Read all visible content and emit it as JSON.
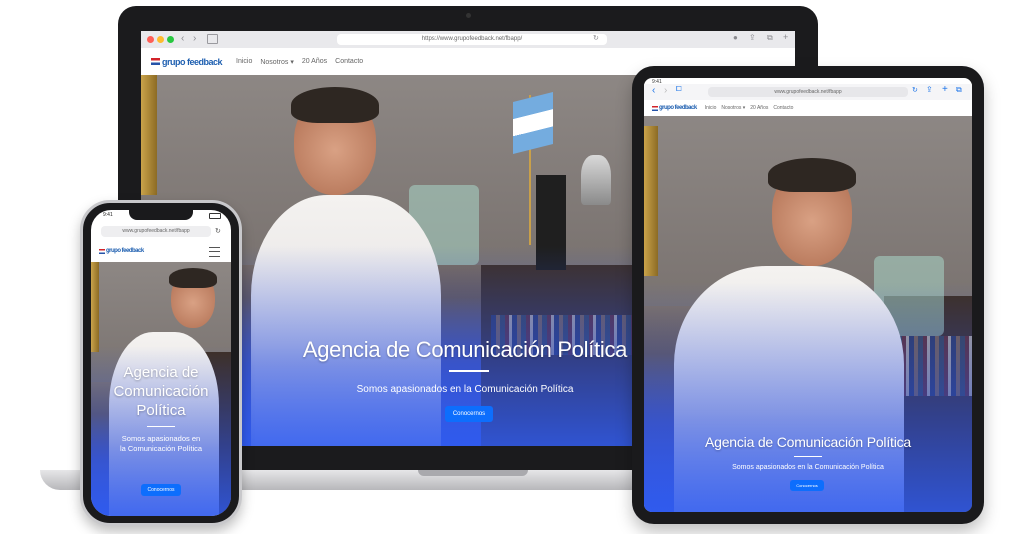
{
  "site": {
    "logo_text": "grupo feedback",
    "logo_tag": "grupo feedback",
    "nav": [
      "Inicio",
      "Nosotros ▾",
      "20 Años",
      "Contacto"
    ],
    "hero_title": "Agencia de Comunicación Política",
    "hero_subtitle": "Somos apasionados en la Comunicación Política",
    "cta_label": "Conocernos"
  },
  "phone_hero_title_lines": [
    "Agencia de",
    "Comunicación",
    "Política"
  ],
  "phone_hero_subtitle_lines": [
    "Somos apasionados en",
    "la Comunicación Política"
  ],
  "laptop": {
    "url": "https://www.grupofeedback.net/fbapp/"
  },
  "tablet": {
    "url": "www.grupofeedback.net/fbapp",
    "time": "9:41"
  },
  "phone": {
    "url": "www.grupofeedback.net/fbapp",
    "time": "9:41"
  },
  "colors": {
    "accent": "#0d6efd",
    "hero_overlay": "#3f5fe0"
  }
}
